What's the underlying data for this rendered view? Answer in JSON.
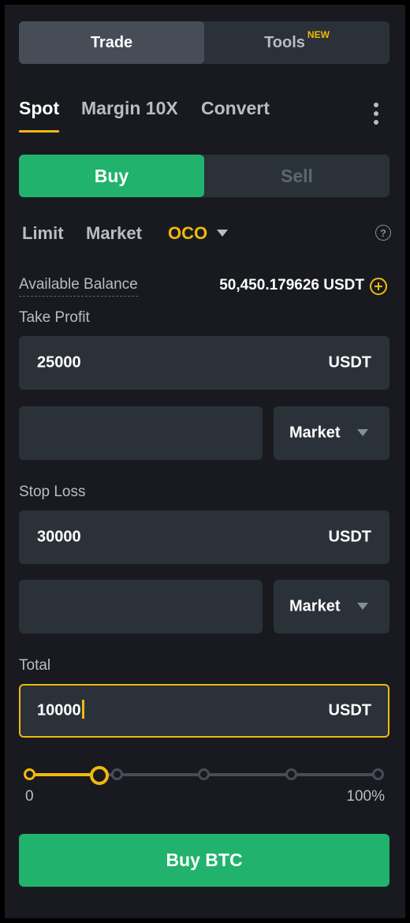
{
  "top_tabs": {
    "trade": "Trade",
    "tools": "Tools",
    "tools_badge": "NEW"
  },
  "account_tabs": [
    "Spot",
    "Margin 10X",
    "Convert"
  ],
  "side": {
    "buy": "Buy",
    "sell": "Sell"
  },
  "order_types": {
    "limit": "Limit",
    "market": "Market",
    "oco": "OCO"
  },
  "help_glyph": "?",
  "balance": {
    "label": "Available Balance",
    "value": "50,450.179626 USDT"
  },
  "take_profit": {
    "label": "Take Profit",
    "price": "25000",
    "unit": "USDT",
    "limit_value": "",
    "type": "Market"
  },
  "stop_loss": {
    "label": "Stop Loss",
    "price": "30000",
    "unit": "USDT",
    "limit_value": "",
    "type": "Market"
  },
  "total": {
    "label": "Total",
    "value": "10000",
    "unit": "USDT"
  },
  "slider": {
    "min_label": "0",
    "max_label": "100%",
    "level": 0.2
  },
  "submit": "Buy BTC",
  "colors": {
    "accent": "#f0b90b",
    "buy": "#21b36d",
    "panel": "#181a20",
    "field": "#2b3139"
  }
}
